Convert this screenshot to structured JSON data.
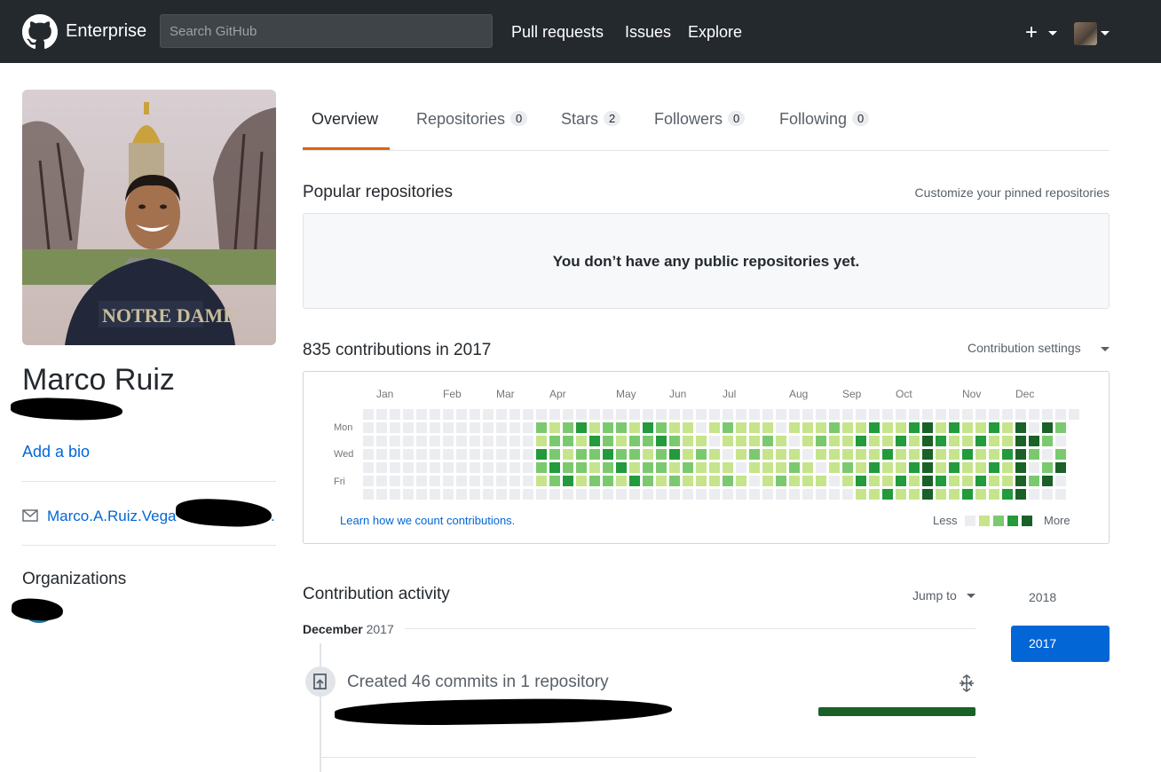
{
  "header": {
    "brand": "Enterprise",
    "search_placeholder": "Search GitHub",
    "nav": [
      "Pull requests",
      "Issues",
      "Explore"
    ],
    "plus": "+",
    "icons": {
      "logo": "github-octocat-icon",
      "plus": "plus-icon",
      "avatar": "avatar-icon"
    }
  },
  "profile": {
    "name": "Marco Ruiz",
    "bio_link": "Add a bio",
    "email": "Marco.A.Ruiz.Vega",
    "email_suffix": ".",
    "organizations_title": "Organizations"
  },
  "tabs": [
    {
      "label": "Overview",
      "count": null,
      "active": true
    },
    {
      "label": "Repositories",
      "count": "0"
    },
    {
      "label": "Stars",
      "count": "2"
    },
    {
      "label": "Followers",
      "count": "0"
    },
    {
      "label": "Following",
      "count": "0"
    }
  ],
  "popular": {
    "title": "Popular repositories",
    "customize": "Customize your pinned repositories",
    "empty": "You don’t have any public repositories yet."
  },
  "contributions": {
    "title": "835 contributions in 2017",
    "settings": "Contribution settings",
    "months": [
      "Jan",
      "Feb",
      "Mar",
      "Apr",
      "May",
      "Jun",
      "Jul",
      "Aug",
      "Sep",
      "Oct",
      "Nov",
      "Dec"
    ],
    "days": [
      "Mon",
      "Wed",
      "Fri"
    ],
    "learn": "Learn how we count contributions.",
    "less": "Less",
    "more": "More",
    "colors": [
      "#ebedf0",
      "#c6e48b",
      "#7bc96f",
      "#239a3b",
      "#196127"
    ]
  },
  "activity": {
    "title": "Contribution activity",
    "jump": "Jump to",
    "month": "December",
    "year": "2017",
    "created": "Created 46 commits in 1 repository",
    "years": [
      "2018",
      "2017"
    ],
    "active_year": "2017"
  }
}
